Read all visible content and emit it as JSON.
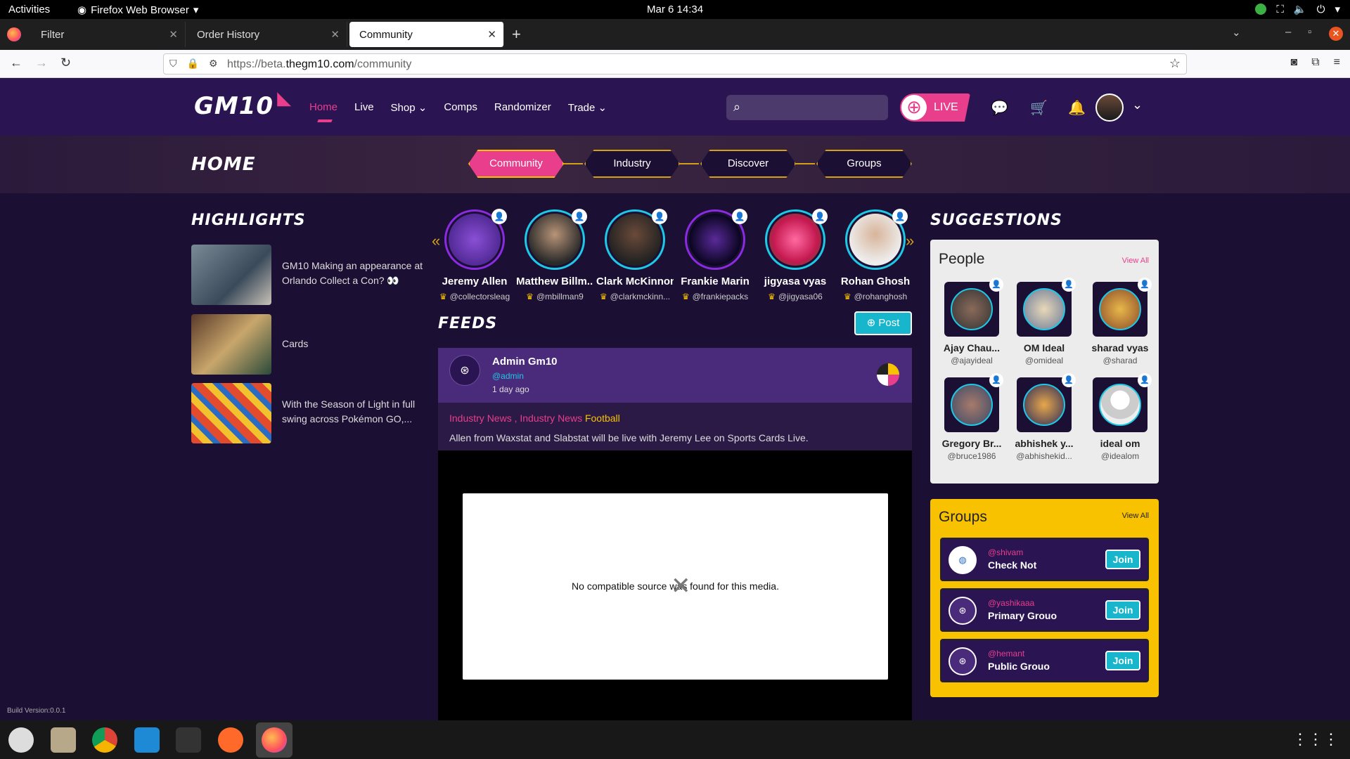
{
  "system": {
    "activities": "Activities",
    "app_name": "Firefox Web Browser",
    "clock": "Mar 6  14:34"
  },
  "browser": {
    "tabs": [
      {
        "label": "Filter"
      },
      {
        "label": "Order History"
      },
      {
        "label": "Community"
      }
    ],
    "url_prefix": "https://beta.",
    "url_domain": "thegm10.com",
    "url_path": "/community"
  },
  "site": {
    "logo": "GM10",
    "nav": [
      "Home",
      "Live",
      "Shop",
      "Comps",
      "Randomizer",
      "Trade"
    ],
    "live_label": "LIVE",
    "search_placeholder": ""
  },
  "hero": {
    "title": "HOME",
    "pills": [
      "Community",
      "Industry",
      "Discover",
      "Groups"
    ]
  },
  "highlights": {
    "title": "HIGHLIGHTS",
    "items": [
      {
        "text": "GM10 Making an appearance at Orlando Collect a Con? 👀"
      },
      {
        "text": "Cards"
      },
      {
        "text": "With the Season of Light in full swing across Pokémon GO,..."
      }
    ]
  },
  "stories": [
    {
      "name": "Jeremy Allen",
      "handle": "@collectorsleag"
    },
    {
      "name": "Matthew Billm...",
      "handle": "@mbillman9"
    },
    {
      "name": "Clark McKinnon",
      "handle": "@clarkmckinn..."
    },
    {
      "name": "Frankie Marin",
      "handle": "@frankiepacks"
    },
    {
      "name": "jigyasa vyas",
      "handle": "@jigyasa06"
    },
    {
      "name": "Rohan Ghosh",
      "handle": "@rohanghosh"
    }
  ],
  "feeds": {
    "title": "FEEDS",
    "post_button": "Post",
    "post": {
      "author": "Admin Gm10",
      "handle": "@admin",
      "time": "1 day ago",
      "tag1": "Industry News ,",
      "tag2": "Industry News",
      "tag3": "Football",
      "description": "Allen from Waxstat and Slabstat will be live with Jeremy Lee on Sports Cards Live.",
      "media_error": "No compatible source was found for this media."
    }
  },
  "suggestions": {
    "title": "SUGGESTIONS",
    "people_title": "People",
    "view_all": "View All",
    "people": [
      {
        "name": "Ajay Chau...",
        "handle": "@ajayideal"
      },
      {
        "name": "OM Ideal",
        "handle": "@omideal"
      },
      {
        "name": "sharad vyas",
        "handle": "@sharad"
      },
      {
        "name": "Gregory Br...",
        "handle": "@bruce1986"
      },
      {
        "name": "abhishek y...",
        "handle": "@abhishekid..."
      },
      {
        "name": "ideal om",
        "handle": "@idealom"
      }
    ],
    "groups_title": "Groups",
    "groups": [
      {
        "handle": "@shivam",
        "name": "Check Not",
        "action": "Join"
      },
      {
        "handle": "@yashikaaa",
        "name": "Primary Grouo",
        "action": "Join"
      },
      {
        "handle": "@hemant",
        "name": "Public Grouo",
        "action": "Join"
      }
    ]
  },
  "footer": {
    "build": "Build Version:0.0.1"
  },
  "colors": {
    "accent": "#e83e8c",
    "gold": "#f8c200",
    "cyan": "#17b6cc",
    "header": "#2a1552"
  }
}
